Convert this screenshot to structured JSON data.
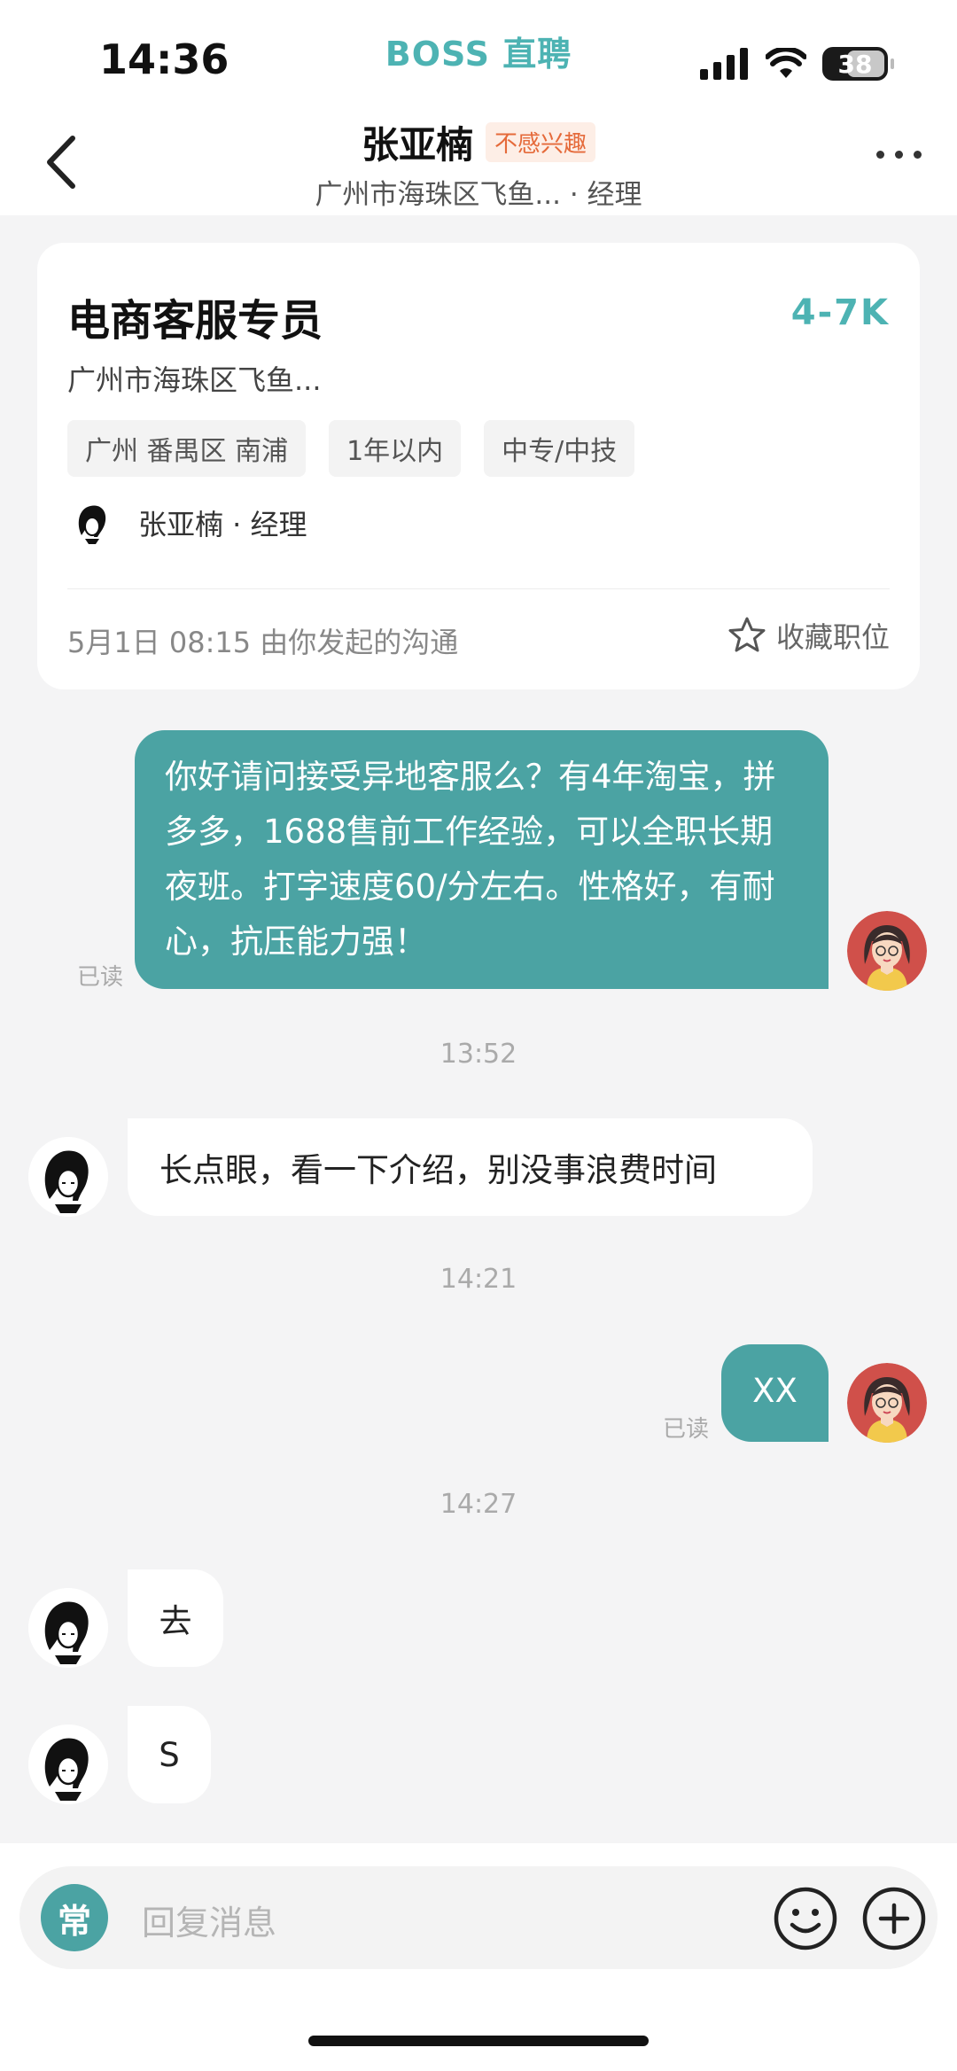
{
  "status_bar": {
    "time": "14:36",
    "app_brand": "BOSS 直聘",
    "battery": "38"
  },
  "header": {
    "back_icon": "chevron-left-icon",
    "name": "张亚楠",
    "tag": "不感兴趣",
    "subtitle": "广州市海珠区飞鱼... · 经理",
    "more_icon": "more-horizontal-icon"
  },
  "job_card": {
    "title": "电商客服专员",
    "salary": "4-7K",
    "address": "广州市海珠区飞鱼...",
    "tags": [
      "广州 番禺区 南浦",
      "1年以内",
      "中专/中技"
    ],
    "recruiter": "张亚楠 · 经理",
    "footer_text": "5月1日 08:15 由你发起的沟通",
    "favorite_label": "收藏职位",
    "favorite_icon": "star-outline-icon"
  },
  "messages": [
    {
      "from": "me",
      "text": "你好请问接受异地客服么？有4年淘宝，拼多多，1688售前工作经验，可以全职长期夜班。打字速度60/分左右。性格好，有耐心，抗压能力强！",
      "status": "已读"
    },
    {
      "type": "timestamp",
      "text": "13:52"
    },
    {
      "from": "them",
      "text": "长点眼，看一下介绍，别没事浪费时间"
    },
    {
      "type": "timestamp",
      "text": "14:21"
    },
    {
      "from": "me",
      "text": "XX",
      "status": "已读"
    },
    {
      "type": "timestamp",
      "text": "14:27"
    },
    {
      "from": "them",
      "text": "去"
    },
    {
      "from": "them",
      "text": "S"
    }
  ],
  "composer": {
    "common_phrase_label": "常",
    "placeholder": "回复消息",
    "emoji_icon": "emoji-smile-icon",
    "plus_icon": "plus-circle-icon"
  },
  "colors": {
    "accent": "#4ba3a3",
    "brand": "#4db3b3",
    "tag_red": "#e56a3a"
  }
}
